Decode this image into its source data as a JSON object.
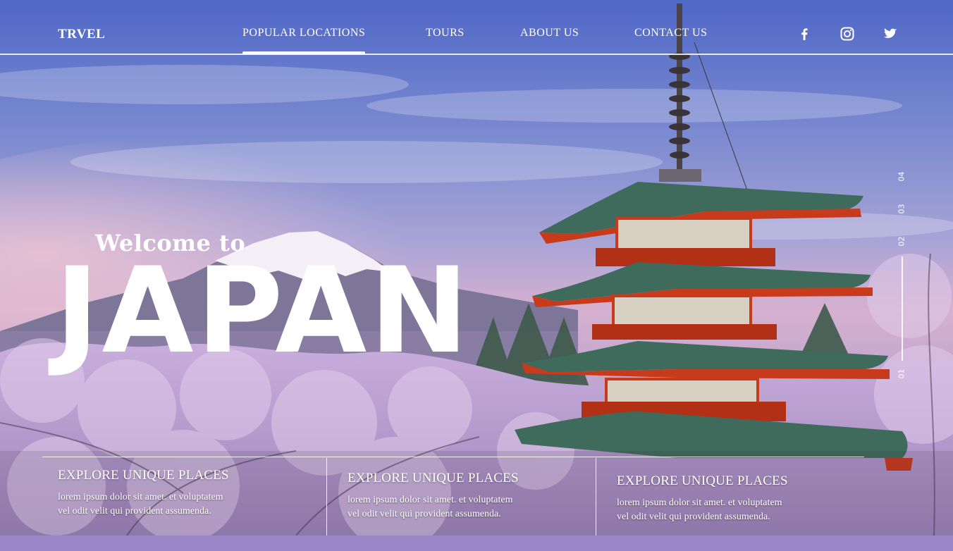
{
  "nav": {
    "logo": "TRVEL",
    "links": [
      {
        "label": "POPULAR LOCATIONS",
        "active": true
      },
      {
        "label": "TOURS"
      },
      {
        "label": "ABOUT US"
      },
      {
        "label": "CONTACT US"
      }
    ],
    "social": [
      "facebook-icon",
      "instagram-icon",
      "twitter-icon"
    ]
  },
  "hero": {
    "welcome": "Welcome to",
    "title": "JAPAN"
  },
  "pager": {
    "items": [
      "04",
      "03",
      "02",
      "01"
    ],
    "active": "01"
  },
  "cards": [
    {
      "title": "EXPLORE UNIQUE PLACES",
      "text_line1": "lorem ipsum dolor sit amet. et voluptatem",
      "text_line2": "vel odit velit qui provident assumenda."
    },
    {
      "title": "EXPLORE UNIQUE PLACES",
      "text_line1": "lorem ipsum dolor sit amet. et voluptatem",
      "text_line2": "vel odit velit qui provident assumenda."
    },
    {
      "title": "EXPLORE UNIQUE PLACES",
      "text_line1": "lorem ipsum dolor sit amet. et voluptatem",
      "text_line2": "vel odit velit qui provident assumenda."
    }
  ],
  "colors": {
    "text": "#ffffff",
    "sky_top": "#5a6fc8",
    "sky_mid": "#8f9ad6",
    "horizon": "#d7b2cf",
    "blossom": "#c8a8d8",
    "pagoda_roof": "#3f6b5c",
    "pagoda_red": "#c83a1c"
  }
}
